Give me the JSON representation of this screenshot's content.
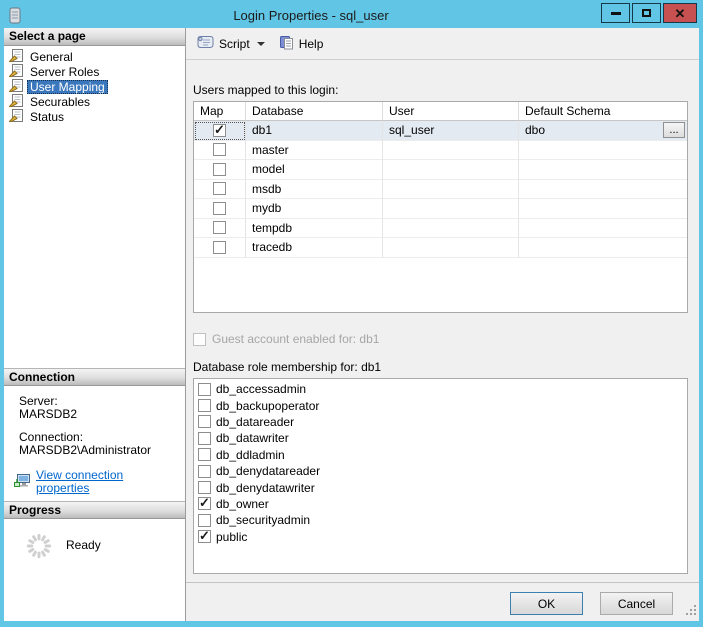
{
  "colors": {
    "frame": "#61C6E5",
    "close_button": "#C75050",
    "selection_blue": "#3B77BC",
    "selected_row": "#E4EAF1",
    "link": "#0066CC"
  },
  "window": {
    "title": "Login Properties - sql_user",
    "icon": "server-scroll-icon",
    "controls": {
      "minimize": "minimize",
      "maximize": "maximize",
      "close": "close"
    }
  },
  "sidebar": {
    "pages": {
      "title": "Select a page",
      "items": [
        {
          "label": "General",
          "selected": false
        },
        {
          "label": "Server Roles",
          "selected": false
        },
        {
          "label": "User Mapping",
          "selected": true
        },
        {
          "label": "Securables",
          "selected": false
        },
        {
          "label": "Status",
          "selected": false
        }
      ]
    },
    "connection": {
      "title": "Connection",
      "server_label": "Server:",
      "server_value": "MARSDB2",
      "connection_label": "Connection:",
      "connection_value": "MARSDB2\\Administrator",
      "link_label": "View connection properties"
    },
    "progress": {
      "title": "Progress",
      "status": "Ready"
    }
  },
  "toolbar": {
    "script_label": "Script",
    "help_label": "Help"
  },
  "main": {
    "users_mapped_label": "Users mapped to this login:",
    "table": {
      "columns": [
        "Map",
        "Database",
        "User",
        "Default Schema"
      ],
      "browse_label": "...",
      "rows": [
        {
          "map": true,
          "database": "db1",
          "user": "sql_user",
          "default_schema": "dbo",
          "selected": true
        },
        {
          "map": false,
          "database": "master",
          "user": "",
          "default_schema": "",
          "selected": false
        },
        {
          "map": false,
          "database": "model",
          "user": "",
          "default_schema": "",
          "selected": false
        },
        {
          "map": false,
          "database": "msdb",
          "user": "",
          "default_schema": "",
          "selected": false
        },
        {
          "map": false,
          "database": "mydb",
          "user": "",
          "default_schema": "",
          "selected": false
        },
        {
          "map": false,
          "database": "tempdb",
          "user": "",
          "default_schema": "",
          "selected": false
        },
        {
          "map": false,
          "database": "tracedb",
          "user": "",
          "default_schema": "",
          "selected": false
        }
      ]
    },
    "guest_label": "Guest account enabled for: db1",
    "guest_checked": false,
    "role_membership_label": "Database role membership for: db1",
    "roles": [
      {
        "name": "db_accessadmin",
        "checked": false
      },
      {
        "name": "db_backupoperator",
        "checked": false
      },
      {
        "name": "db_datareader",
        "checked": false
      },
      {
        "name": "db_datawriter",
        "checked": false
      },
      {
        "name": "db_ddladmin",
        "checked": false
      },
      {
        "name": "db_denydatareader",
        "checked": false
      },
      {
        "name": "db_denydatawriter",
        "checked": false
      },
      {
        "name": "db_owner",
        "checked": true
      },
      {
        "name": "db_securityadmin",
        "checked": false
      },
      {
        "name": "public",
        "checked": true
      }
    ]
  },
  "footer": {
    "ok_label": "OK",
    "cancel_label": "Cancel"
  }
}
